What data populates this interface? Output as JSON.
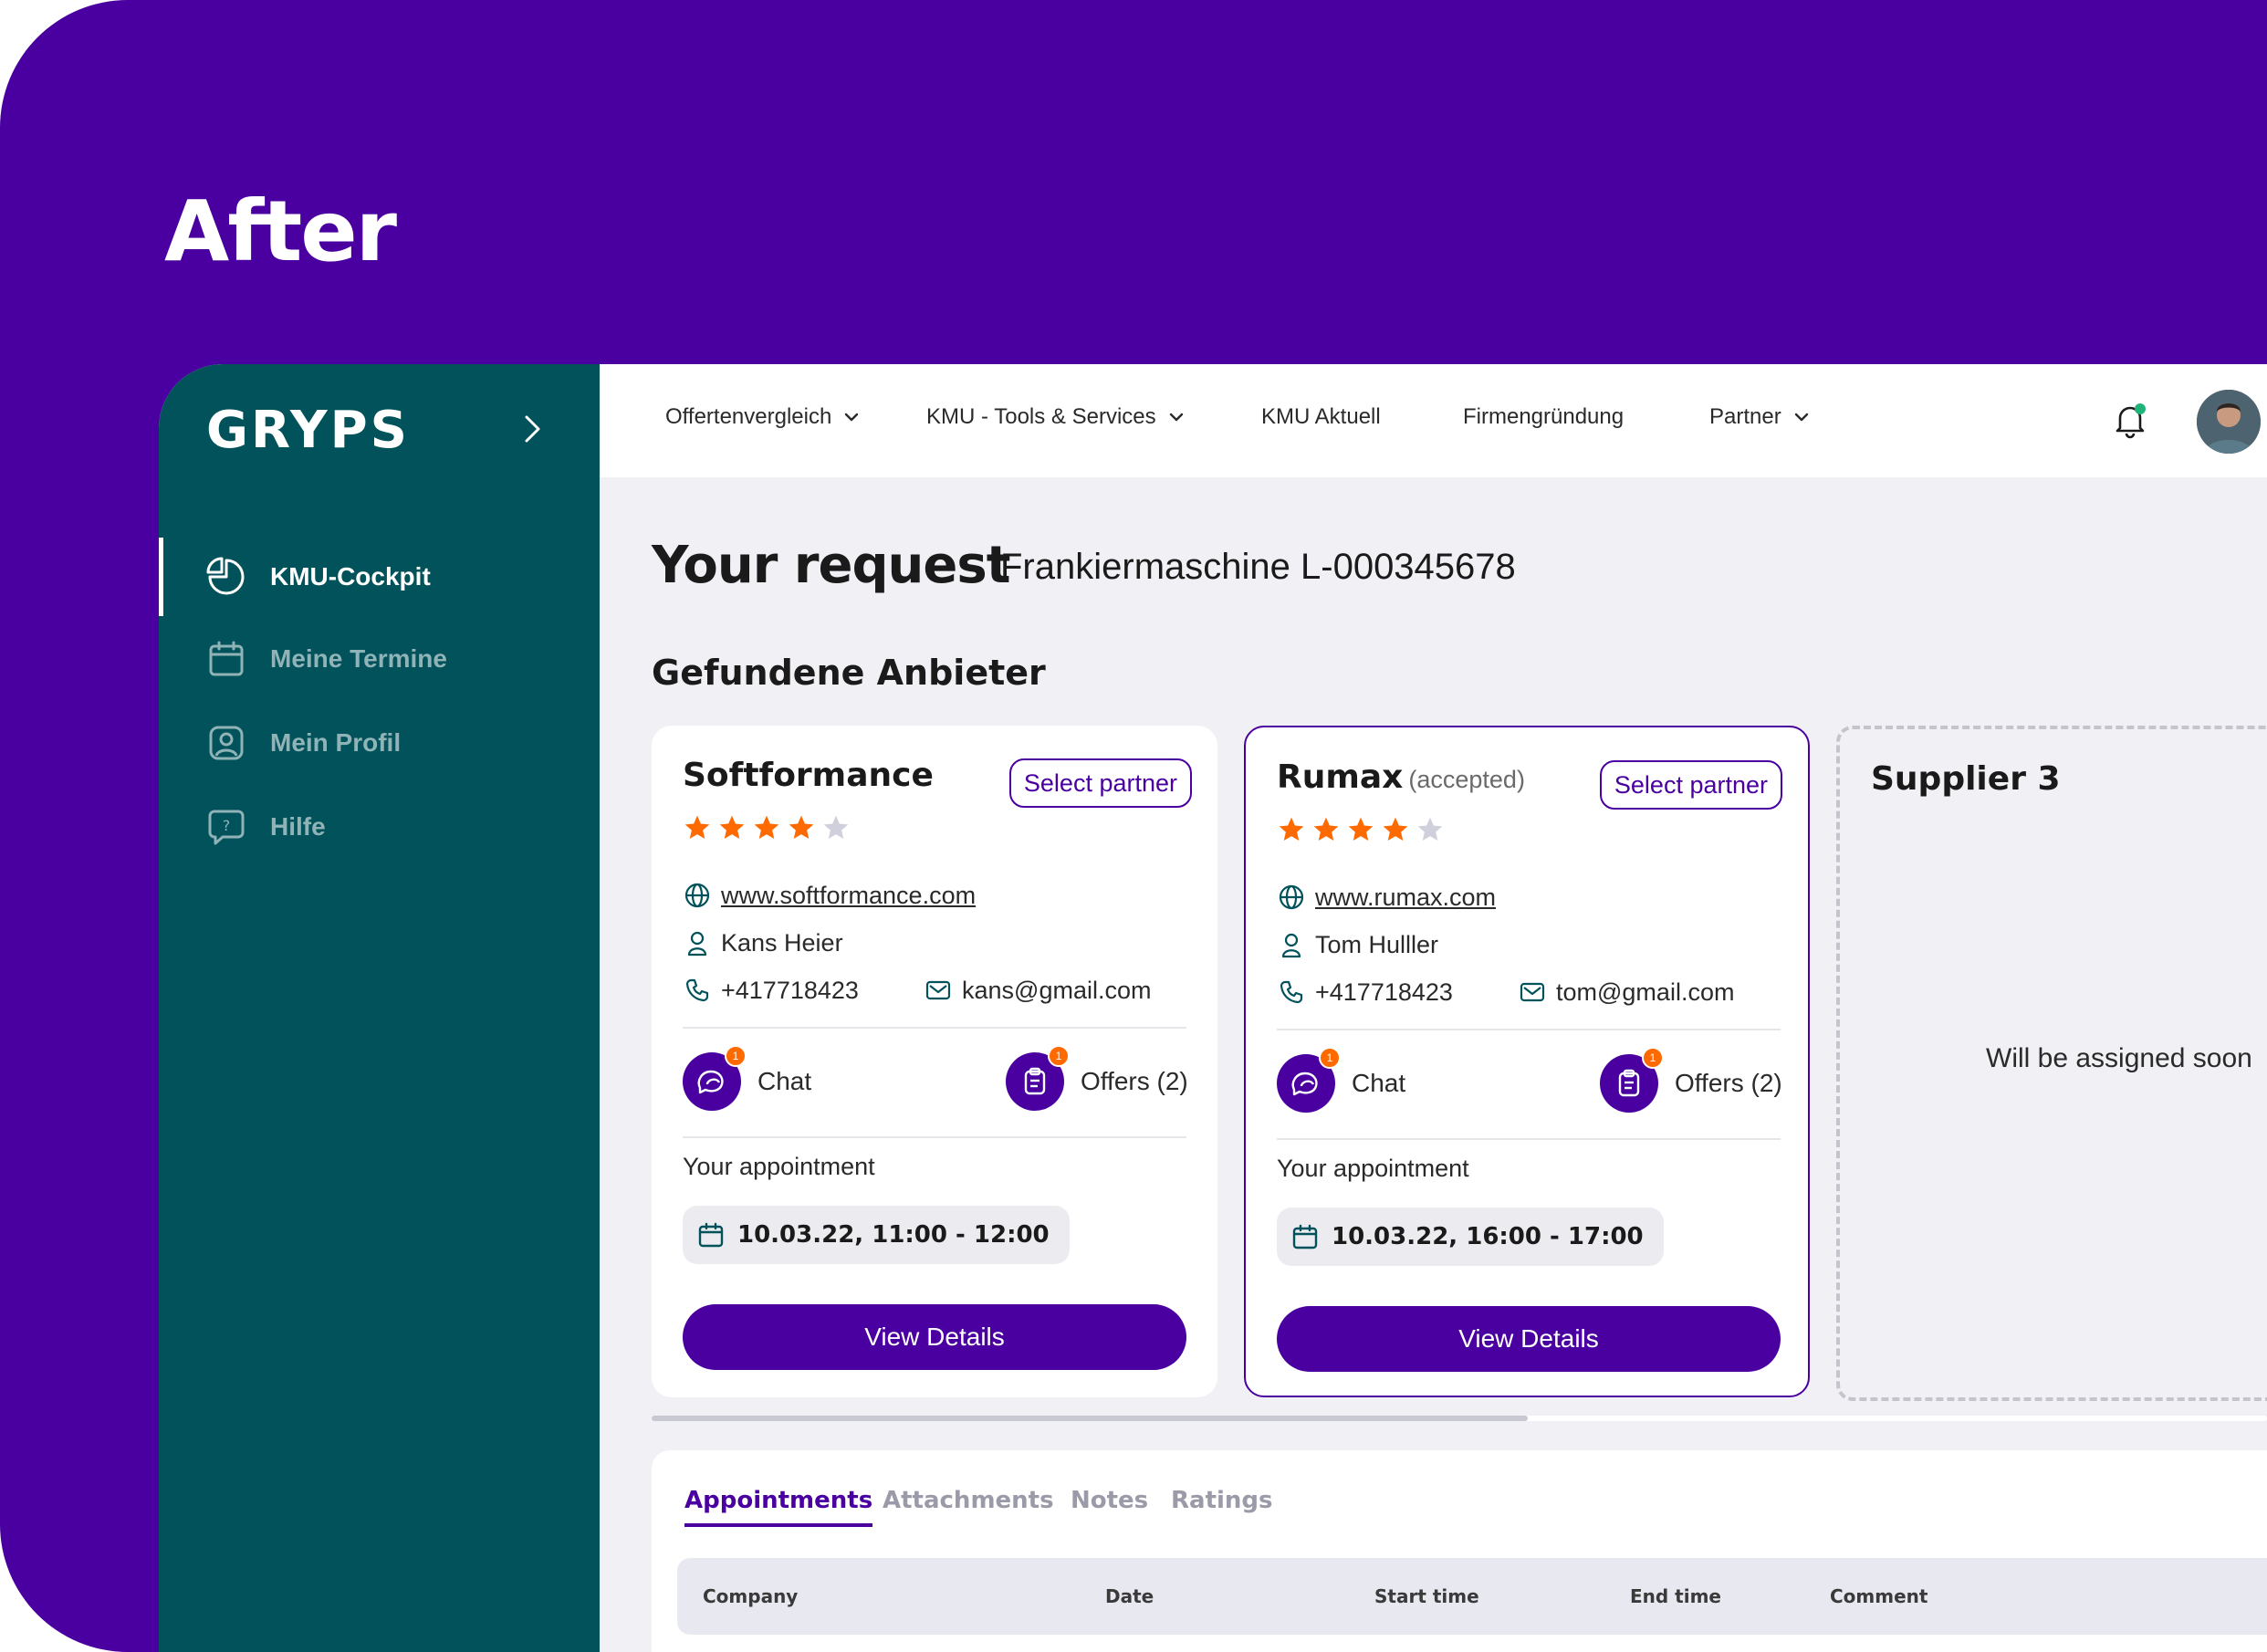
{
  "heading": "After",
  "sidebar": {
    "logo": "GRYPS",
    "items": [
      {
        "label": "KMU-Cockpit",
        "icon": "pie-chart-icon",
        "active": true
      },
      {
        "label": "Meine Termine",
        "icon": "calendar-icon",
        "active": false
      },
      {
        "label": "Mein Profil",
        "icon": "user-profile-icon",
        "active": false
      },
      {
        "label": "Hilfe",
        "icon": "help-bubble-icon",
        "active": false
      }
    ]
  },
  "topnav": {
    "items": [
      {
        "label": "Offertenvergleich",
        "has_dropdown": true
      },
      {
        "label": "KMU - Tools & Services",
        "has_dropdown": true
      },
      {
        "label": "KMU Aktuell",
        "has_dropdown": false
      },
      {
        "label": "Firmengründung",
        "has_dropdown": false
      },
      {
        "label": "Partner",
        "has_dropdown": true
      }
    ]
  },
  "page": {
    "title": "Your request",
    "subtitle": "Frankiermaschine L-000345678",
    "section": "Gefundene Anbieter"
  },
  "suppliers": [
    {
      "name": "Softformance",
      "status": "",
      "select_label": "Select partner",
      "rating": 4,
      "rating_max": 5,
      "website": "www.softformance.com",
      "contact": "Kans Heier",
      "phone": "+417718423",
      "email": "kans@gmail.com",
      "chat_label": "Chat",
      "chat_badge": "1",
      "offers_label": "Offers (2)",
      "offers_badge": "1",
      "appointment_label": "Your appointment",
      "appointment": "10.03.22, 11:00 - 12:00",
      "details_label": "View Details"
    },
    {
      "name": "Rumax",
      "status": "(accepted)",
      "select_label": "Select partner",
      "rating": 4,
      "rating_max": 5,
      "website": "www.rumax.com",
      "contact": "Tom Hulller",
      "phone": "+417718423",
      "email": "tom@gmail.com",
      "chat_label": "Chat",
      "chat_badge": "1",
      "offers_label": "Offers (2)",
      "offers_badge": "1",
      "appointment_label": "Your appointment",
      "appointment": "10.03.22, 16:00 - 17:00",
      "details_label": "View Details"
    }
  ],
  "placeholder_supplier": {
    "name": "Supplier 3",
    "message": "Will be assigned soon"
  },
  "tabs": [
    "Appointments",
    "Attachments",
    "Notes",
    "Ratings"
  ],
  "table": {
    "columns": [
      "Company",
      "Date",
      "Start time",
      "End time",
      "Comment"
    ]
  },
  "colors": {
    "brand_purple": "#4a00a0",
    "sidebar_teal": "#01525a",
    "star_orange": "#ff6a00",
    "star_empty": "#cfd0dc",
    "notification_dot": "#1fb37a"
  }
}
